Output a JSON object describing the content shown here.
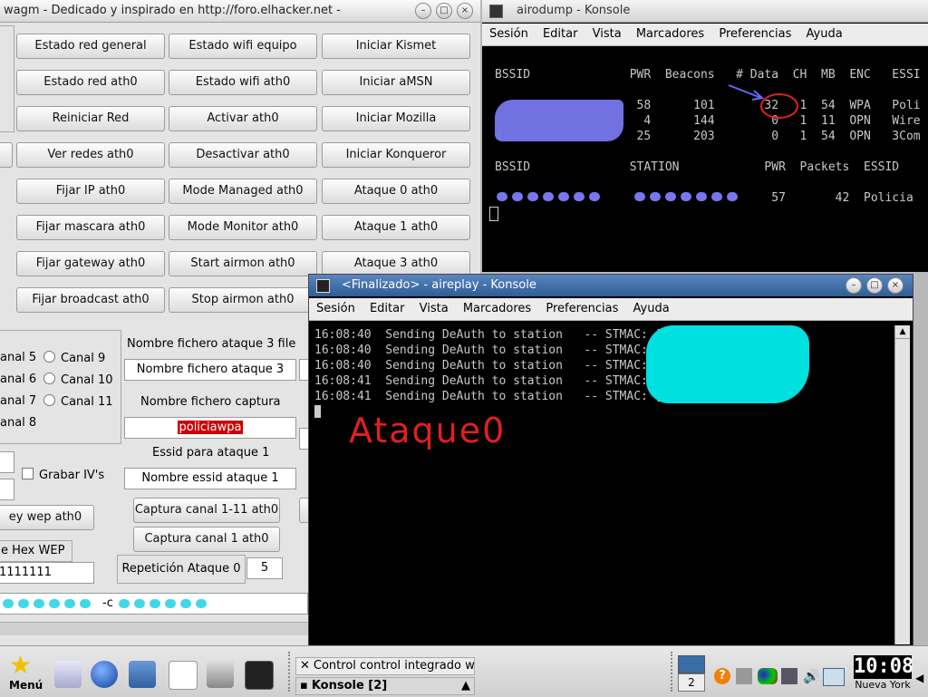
{
  "left_window": {
    "title": "wagm - Dedicado y inspirado en http://foro.elhacker.net -",
    "buttons": [
      [
        "Estado red general",
        "Estado wifi equipo",
        "Iniciar Kismet"
      ],
      [
        "Estado red ath0",
        "Estado wifi ath0",
        "Iniciar aMSN"
      ],
      [
        "Reiniciar Red",
        "Activar ath0",
        "Iniciar Mozilla"
      ],
      [
        "Ver redes ath0",
        "Desactivar ath0",
        "Iniciar Konqueror"
      ],
      [
        "Fijar IP ath0",
        "Mode Managed ath0",
        "Ataque 0 ath0"
      ],
      [
        "Fijar mascara ath0",
        "Mode Monitor ath0",
        "Ataque 1 ath0"
      ],
      [
        "Fijar gateway ath0",
        "Start airmon ath0",
        "Ataque 3 ath0"
      ],
      [
        "Fijar broadcast ath0",
        "Stop airmon ath0",
        ""
      ]
    ],
    "channels_left": [
      "anal 5",
      "anal 6",
      "anal 7",
      "anal 8"
    ],
    "channels_right": [
      "Canal 9",
      "Canal 10",
      "Canal 11"
    ],
    "label_file_attack3": "Nombre fichero ataque 3 file",
    "field_file_attack3": "Nombre fichero ataque 3",
    "label_capture_file": "Nombre fichero captura",
    "field_capture_file": "policiawpa",
    "label_essid_attack1": "Essid para ataque 1",
    "field_essid_attack1": "Nombre essid ataque 1",
    "checkbox_ivs": "Grabar IV's",
    "button_key_wep": "ey wep ath0",
    "button_capture_all": "Captura canal 1-11 ath0",
    "button_capture_1": "Captura canal 1 ath0",
    "label_hex_wep": "e Hex WEP",
    "field_hex_wep": "1111111",
    "label_repeat": "Repetición Ataque 0",
    "field_repeat": "5",
    "command_line_flag": "-c"
  },
  "airodump": {
    "title": "airodump - Konsole",
    "menu": [
      "Sesión",
      "Editar",
      "Vista",
      "Marcadores",
      "Preferencias",
      "Ayuda"
    ],
    "ap_header": "BSSID              PWR  Beacons   # Data  CH  MB  ENC   ESSI",
    "ap_rows": [
      "                    58      101       32   1  54  WPA   Poli",
      "                     4      144        0   1  11  OPN   Wire",
      "0                   25      203        0   1  54  OPN   3Com"
    ],
    "station_header": "BSSID              STATION            PWR  Packets  ESSID",
    "station_rows": [
      "                                       57       42  Policia"
    ]
  },
  "aireplay": {
    "title": "<Finalizado> - aireplay - Konsole",
    "menu": [
      "Sesión",
      "Editar",
      "Vista",
      "Marcadores",
      "Preferencias",
      "Ayuda"
    ],
    "lines": [
      "16:08:40  Sending DeAuth to station   -- STMAC: [",
      "16:08:40  Sending DeAuth to station   -- STMAC: [",
      "16:08:40  Sending DeAuth to station   -- STMAC: [",
      "16:08:41  Sending DeAuth to station   -- STMAC: [",
      "16:08:41  Sending DeAuth to station   -- STMAC: ["
    ],
    "annotation": "Ataque0"
  },
  "taskbar": {
    "menu_label": "Menú",
    "task1": "Control control integrado w",
    "task2": "Konsole [2]",
    "desktop_number": "2",
    "clock_time": "10:08",
    "clock_zone": "Nueva York"
  },
  "colors": {
    "terminal_bg": "#000000",
    "terminal_text": "#c8c8c8",
    "titlebar_active": "#3a6ea5",
    "highlight_field": "#cc0000",
    "scribble_blue": "#7777ee",
    "scribble_cyan": "#00e0e0",
    "annotation_red": "#e02020"
  }
}
